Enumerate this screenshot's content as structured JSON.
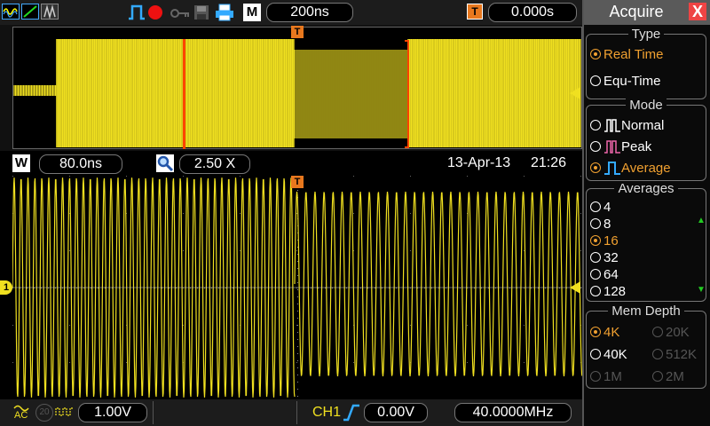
{
  "top_bar": {
    "timebase": "200ns",
    "trigger_icon": "T",
    "trigger_position": "0.000s",
    "m_icon": "M"
  },
  "window_bar": {
    "w_icon": "W",
    "window_timebase": "80.0ns",
    "zoom": "2.50 X",
    "date": "13-Apr-13",
    "time": "21:26"
  },
  "bottom_bar": {
    "coupling": "AC",
    "bw_limit": "20",
    "ch1_scale": "1.00V",
    "trigger_source": "CH1",
    "trigger_level": "0.00V",
    "frequency": "40.0000MHz"
  },
  "markers": {
    "ch1": "1",
    "trigger": "T"
  },
  "menu": {
    "title": "Acquire",
    "close": "X",
    "type": {
      "heading": "Type",
      "options": [
        "Real Time",
        "Equ-Time"
      ],
      "selected": 0
    },
    "mode": {
      "heading": "Mode",
      "options": [
        "Normal",
        "Peak",
        "Average"
      ],
      "selected": 2
    },
    "averages": {
      "heading": "Averages",
      "options": [
        "4",
        "8",
        "16",
        "32",
        "64",
        "128"
      ],
      "selected": 2
    },
    "mem_depth": {
      "heading": "Mem Depth",
      "options": [
        "4K",
        "20K",
        "40K",
        "512K",
        "1M",
        "2M"
      ],
      "selected": 0
    }
  },
  "colors": {
    "trace": "#f0e020",
    "accent": "#e8781e",
    "cursor": "#ff4400",
    "selected_option": "#f0a030",
    "grid": "#555555"
  }
}
